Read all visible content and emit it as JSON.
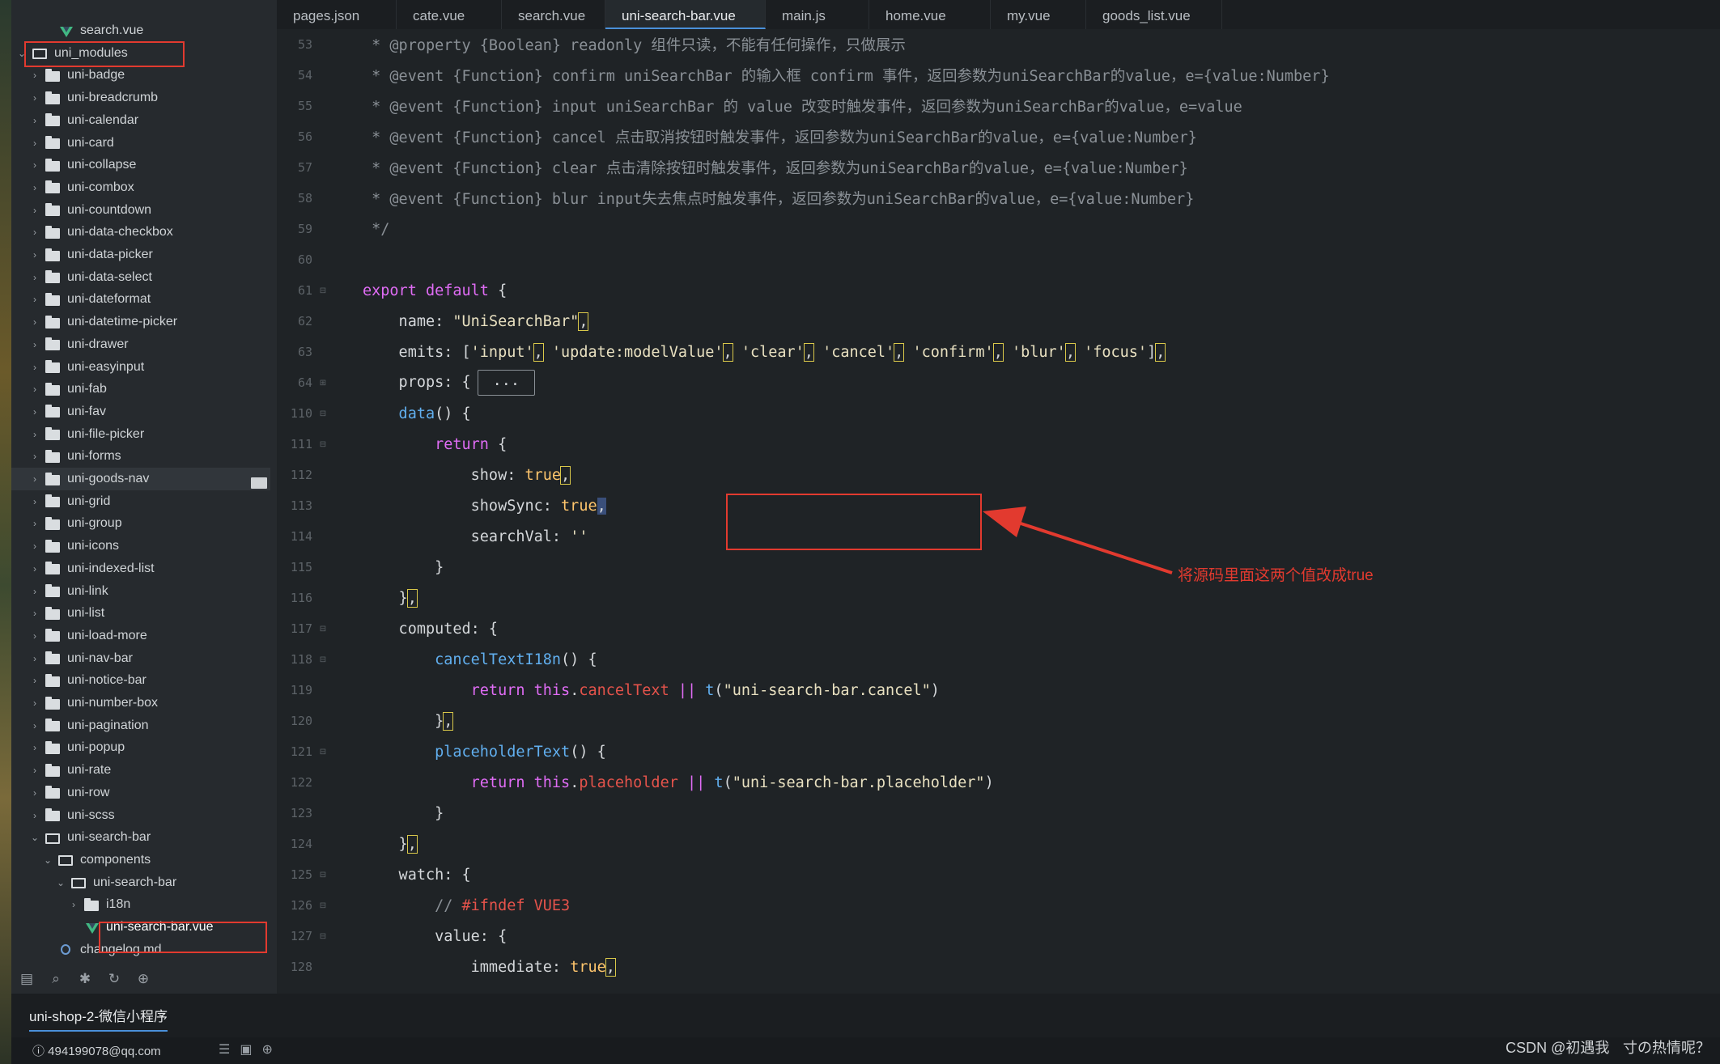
{
  "sidebar": {
    "items": [
      {
        "label": "search.vue",
        "icon": "vue-file-icon",
        "depth": 3,
        "chevron": ""
      },
      {
        "label": "uni_modules",
        "icon": "folder-open-icon",
        "depth": 1,
        "chevron": "⌄"
      },
      {
        "label": "uni-badge",
        "icon": "folder-icon",
        "depth": 2,
        "chevron": "›"
      },
      {
        "label": "uni-breadcrumb",
        "icon": "folder-icon",
        "depth": 2,
        "chevron": "›"
      },
      {
        "label": "uni-calendar",
        "icon": "folder-icon",
        "depth": 2,
        "chevron": "›"
      },
      {
        "label": "uni-card",
        "icon": "folder-icon",
        "depth": 2,
        "chevron": "›"
      },
      {
        "label": "uni-collapse",
        "icon": "folder-icon",
        "depth": 2,
        "chevron": "›"
      },
      {
        "label": "uni-combox",
        "icon": "folder-icon",
        "depth": 2,
        "chevron": "›"
      },
      {
        "label": "uni-countdown",
        "icon": "folder-icon",
        "depth": 2,
        "chevron": "›"
      },
      {
        "label": "uni-data-checkbox",
        "icon": "folder-icon",
        "depth": 2,
        "chevron": "›"
      },
      {
        "label": "uni-data-picker",
        "icon": "folder-icon",
        "depth": 2,
        "chevron": "›"
      },
      {
        "label": "uni-data-select",
        "icon": "folder-icon",
        "depth": 2,
        "chevron": "›"
      },
      {
        "label": "uni-dateformat",
        "icon": "folder-icon",
        "depth": 2,
        "chevron": "›"
      },
      {
        "label": "uni-datetime-picker",
        "icon": "folder-icon",
        "depth": 2,
        "chevron": "›"
      },
      {
        "label": "uni-drawer",
        "icon": "folder-icon",
        "depth": 2,
        "chevron": "›"
      },
      {
        "label": "uni-easyinput",
        "icon": "folder-icon",
        "depth": 2,
        "chevron": "›"
      },
      {
        "label": "uni-fab",
        "icon": "folder-icon",
        "depth": 2,
        "chevron": "›"
      },
      {
        "label": "uni-fav",
        "icon": "folder-icon",
        "depth": 2,
        "chevron": "›"
      },
      {
        "label": "uni-file-picker",
        "icon": "folder-icon",
        "depth": 2,
        "chevron": "›"
      },
      {
        "label": "uni-forms",
        "icon": "folder-icon",
        "depth": 2,
        "chevron": "›"
      },
      {
        "label": "uni-goods-nav",
        "icon": "folder-icon",
        "depth": 2,
        "chevron": "›"
      },
      {
        "label": "uni-grid",
        "icon": "folder-icon",
        "depth": 2,
        "chevron": "›"
      },
      {
        "label": "uni-group",
        "icon": "folder-icon",
        "depth": 2,
        "chevron": "›"
      },
      {
        "label": "uni-icons",
        "icon": "folder-icon",
        "depth": 2,
        "chevron": "›"
      },
      {
        "label": "uni-indexed-list",
        "icon": "folder-icon",
        "depth": 2,
        "chevron": "›"
      },
      {
        "label": "uni-link",
        "icon": "folder-icon",
        "depth": 2,
        "chevron": "›"
      },
      {
        "label": "uni-list",
        "icon": "folder-icon",
        "depth": 2,
        "chevron": "›"
      },
      {
        "label": "uni-load-more",
        "icon": "folder-icon",
        "depth": 2,
        "chevron": "›"
      },
      {
        "label": "uni-nav-bar",
        "icon": "folder-icon",
        "depth": 2,
        "chevron": "›"
      },
      {
        "label": "uni-notice-bar",
        "icon": "folder-icon",
        "depth": 2,
        "chevron": "›"
      },
      {
        "label": "uni-number-box",
        "icon": "folder-icon",
        "depth": 2,
        "chevron": "›"
      },
      {
        "label": "uni-pagination",
        "icon": "folder-icon",
        "depth": 2,
        "chevron": "›"
      },
      {
        "label": "uni-popup",
        "icon": "folder-icon",
        "depth": 2,
        "chevron": "›"
      },
      {
        "label": "uni-rate",
        "icon": "folder-icon",
        "depth": 2,
        "chevron": "›"
      },
      {
        "label": "uni-row",
        "icon": "folder-icon",
        "depth": 2,
        "chevron": "›"
      },
      {
        "label": "uni-scss",
        "icon": "folder-icon",
        "depth": 2,
        "chevron": "›"
      },
      {
        "label": "uni-search-bar",
        "icon": "folder-open-icon",
        "depth": 2,
        "chevron": "⌄"
      },
      {
        "label": "components",
        "icon": "folder-open-icon",
        "depth": 3,
        "chevron": "⌄"
      },
      {
        "label": "uni-search-bar",
        "icon": "folder-open-icon",
        "depth": 4,
        "chevron": "⌄"
      },
      {
        "label": "i18n",
        "icon": "folder-icon",
        "depth": 5,
        "chevron": "›"
      },
      {
        "label": "uni-search-bar.vue",
        "icon": "vue-file-icon",
        "depth": 5,
        "chevron": ""
      },
      {
        "label": "changelog.md",
        "icon": "markdown-file-icon",
        "depth": 3,
        "chevron": ""
      }
    ],
    "toolbar": [
      "file-tree-icon",
      "search-icon",
      "debug-icon",
      "refresh-icon",
      "globe-icon"
    ]
  },
  "tabs": [
    {
      "label": "pages.json",
      "active": false
    },
    {
      "label": "cate.vue",
      "active": false
    },
    {
      "label": "search.vue",
      "active": false
    },
    {
      "label": "uni-search-bar.vue",
      "active": true
    },
    {
      "label": "main.js",
      "active": false
    },
    {
      "label": "home.vue",
      "active": false
    },
    {
      "label": "my.vue",
      "active": false
    },
    {
      "label": "goods_list.vue",
      "active": false
    }
  ],
  "editor": {
    "lines": [
      {
        "n": "53",
        "fold": "",
        "tokens": [
          [
            "cm",
            " * @property {Boolean} readonly 组件只读，不能有任何操作，只做展示"
          ]
        ]
      },
      {
        "n": "54",
        "fold": "",
        "tokens": [
          [
            "cm",
            " * @event {Function} confirm uniSearchBar 的输入框 confirm 事件，返回参数为uniSearchBar的value，e={value:Number}"
          ]
        ]
      },
      {
        "n": "55",
        "fold": "",
        "tokens": [
          [
            "cm",
            " * @event {Function} input uniSearchBar 的 value 改变时触发事件，返回参数为uniSearchBar的value，e=value"
          ]
        ]
      },
      {
        "n": "56",
        "fold": "",
        "tokens": [
          [
            "cm",
            " * @event {Function} cancel 点击取消按钮时触发事件，返回参数为uniSearchBar的value，e={value:Number}"
          ]
        ]
      },
      {
        "n": "57",
        "fold": "",
        "tokens": [
          [
            "cm",
            " * @event {Function} clear 点击清除按钮时触发事件，返回参数为uniSearchBar的value，e={value:Number}"
          ]
        ]
      },
      {
        "n": "58",
        "fold": "",
        "tokens": [
          [
            "cm",
            " * @event {Function} blur input失去焦点时触发事件，返回参数为uniSearchBar的value，e={value:Number}"
          ]
        ]
      },
      {
        "n": "59",
        "fold": "",
        "tokens": [
          [
            "cm",
            " */"
          ]
        ]
      },
      {
        "n": "60",
        "fold": "",
        "tokens": []
      },
      {
        "n": "61",
        "fold": "⊟",
        "tokens": [
          [
            "kw",
            "export default"
          ],
          [
            "pun",
            " {"
          ]
        ]
      },
      {
        "n": "62",
        "fold": "",
        "tokens": [
          [
            "prop",
            "    name: "
          ],
          [
            "str",
            "\"UniSearchBar\""
          ],
          [
            "hl",
            ","
          ]
        ]
      },
      {
        "n": "63",
        "fold": "",
        "tokens": [
          [
            "prop",
            "    emits: ["
          ],
          [
            "str",
            "'input'"
          ],
          [
            "hl",
            ","
          ],
          [
            "pun",
            " "
          ],
          [
            "str",
            "'update:modelValue'"
          ],
          [
            "hl",
            ","
          ],
          [
            "pun",
            " "
          ],
          [
            "str",
            "'clear'"
          ],
          [
            "hl",
            ","
          ],
          [
            "pun",
            " "
          ],
          [
            "str",
            "'cancel'"
          ],
          [
            "hl",
            ","
          ],
          [
            "pun",
            " "
          ],
          [
            "str",
            "'confirm'"
          ],
          [
            "hl",
            ","
          ],
          [
            "pun",
            " "
          ],
          [
            "str",
            "'blur'"
          ],
          [
            "hl",
            ","
          ],
          [
            "pun",
            " "
          ],
          [
            "str",
            "'focus'"
          ],
          [
            "pun",
            "]"
          ],
          [
            "hl",
            ","
          ]
        ]
      },
      {
        "n": "64",
        "fold": "⊞",
        "tokens": [
          [
            "prop",
            "    props: {"
          ],
          [
            "collapsed",
            "..."
          ]
        ]
      },
      {
        "n": "110",
        "fold": "⊟",
        "tokens": [
          [
            "fn",
            "    data"
          ],
          [
            "pun",
            "() {"
          ]
        ]
      },
      {
        "n": "111",
        "fold": "⊟",
        "tokens": [
          [
            "kw",
            "        return"
          ],
          [
            "pun",
            " {"
          ]
        ]
      },
      {
        "n": "112",
        "fold": "",
        "tokens": [
          [
            "prop",
            "            show: "
          ],
          [
            "bool",
            "true"
          ],
          [
            "hl",
            ","
          ]
        ]
      },
      {
        "n": "113",
        "fold": "",
        "tokens": [
          [
            "prop",
            "            showSync: "
          ],
          [
            "bool",
            "true"
          ],
          [
            "cur",
            ","
          ]
        ]
      },
      {
        "n": "114",
        "fold": "",
        "tokens": [
          [
            "prop",
            "            searchVal: "
          ],
          [
            "str",
            "''"
          ]
        ]
      },
      {
        "n": "115",
        "fold": "",
        "tokens": [
          [
            "pun",
            "        }"
          ]
        ]
      },
      {
        "n": "116",
        "fold": "",
        "tokens": [
          [
            "pun",
            "    }"
          ],
          [
            "hl",
            ","
          ]
        ]
      },
      {
        "n": "117",
        "fold": "⊟",
        "tokens": [
          [
            "prop",
            "    computed: {"
          ]
        ]
      },
      {
        "n": "118",
        "fold": "⊟",
        "tokens": [
          [
            "fn",
            "        cancelTextI18n"
          ],
          [
            "pun",
            "() {"
          ]
        ]
      },
      {
        "n": "119",
        "fold": "",
        "tokens": [
          [
            "kw",
            "            return this"
          ],
          [
            "pun",
            "."
          ],
          [
            "pre",
            "cancelText"
          ],
          [
            "pun",
            " "
          ],
          [
            "kw",
            "||"
          ],
          [
            "pun",
            " "
          ],
          [
            "fn",
            "t"
          ],
          [
            "pun",
            "("
          ],
          [
            "str",
            "\"uni-search-bar.cancel\""
          ],
          [
            "pun",
            ")"
          ]
        ]
      },
      {
        "n": "120",
        "fold": "",
        "tokens": [
          [
            "pun",
            "        }"
          ],
          [
            "hl",
            ","
          ]
        ]
      },
      {
        "n": "121",
        "fold": "⊟",
        "tokens": [
          [
            "fn",
            "        placeholderText"
          ],
          [
            "pun",
            "() {"
          ]
        ]
      },
      {
        "n": "122",
        "fold": "",
        "tokens": [
          [
            "kw",
            "            return this"
          ],
          [
            "pun",
            "."
          ],
          [
            "pre",
            "placeholder"
          ],
          [
            "pun",
            " "
          ],
          [
            "kw",
            "||"
          ],
          [
            "pun",
            " "
          ],
          [
            "fn",
            "t"
          ],
          [
            "pun",
            "("
          ],
          [
            "str",
            "\"uni-search-bar.placeholder\""
          ],
          [
            "pun",
            ")"
          ]
        ]
      },
      {
        "n": "123",
        "fold": "",
        "tokens": [
          [
            "pun",
            "        }"
          ]
        ]
      },
      {
        "n": "124",
        "fold": "",
        "tokens": [
          [
            "pun",
            "    }"
          ],
          [
            "hl",
            ","
          ]
        ]
      },
      {
        "n": "125",
        "fold": "⊟",
        "tokens": [
          [
            "prop",
            "    watch: {"
          ]
        ]
      },
      {
        "n": "126",
        "fold": "⊟",
        "tokens": [
          [
            "cm",
            "        // "
          ],
          [
            "pre",
            "#ifndef VUE3"
          ]
        ]
      },
      {
        "n": "127",
        "fold": "⊟",
        "tokens": [
          [
            "prop",
            "        value: {"
          ]
        ]
      },
      {
        "n": "128",
        "fold": "",
        "tokens": [
          [
            "prop",
            "            immediate: "
          ],
          [
            "bool",
            "true"
          ],
          [
            "hl",
            ","
          ]
        ]
      }
    ]
  },
  "annotation": {
    "text": "将源码里面这两个值改成true",
    "color": "#e23a2f"
  },
  "bottom": {
    "project": "uni-shop-2-微信小程序"
  },
  "status": {
    "account": "494199078@qq.com",
    "watermark": "CSDN @初遇我ㅤ寸の热情呢？"
  }
}
